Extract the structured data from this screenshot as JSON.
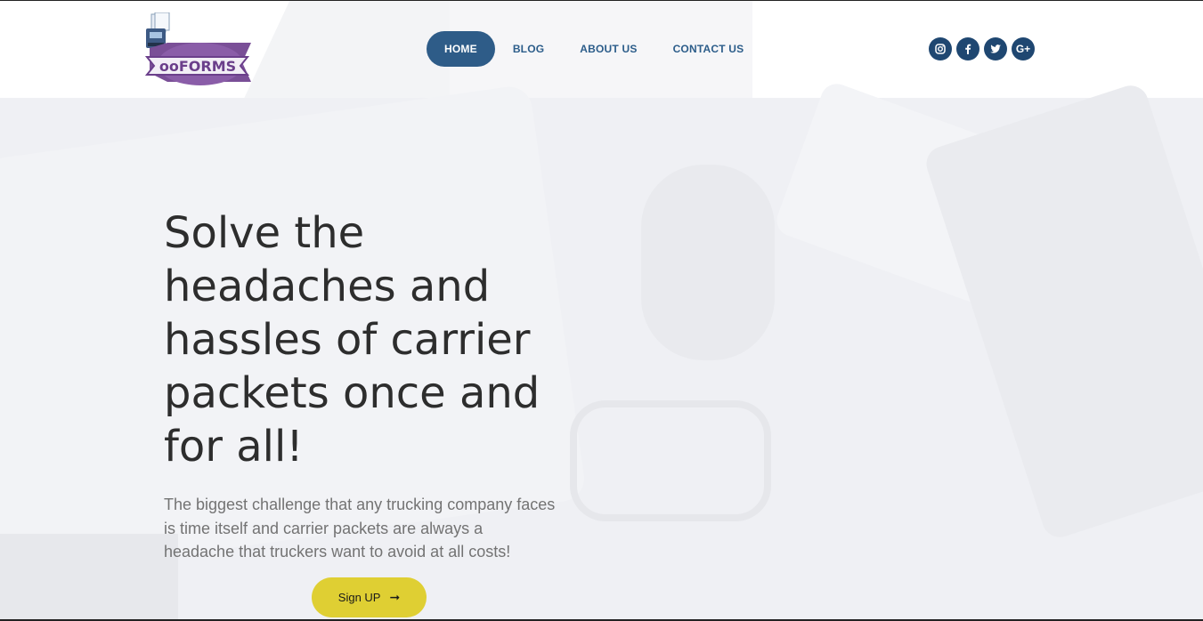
{
  "brand": {
    "logo_text": "ooFORMS",
    "logo_color": "#7a4f97"
  },
  "nav": {
    "items": [
      {
        "label": "HOME",
        "active": true
      },
      {
        "label": "BLOG",
        "active": false
      },
      {
        "label": "ABOUT US",
        "active": false
      },
      {
        "label": "CONTACT US",
        "active": false
      }
    ]
  },
  "social": {
    "icons": [
      "instagram-icon",
      "facebook-icon",
      "twitter-icon",
      "google-plus-icon"
    ],
    "google_plus_text": "G+"
  },
  "hero": {
    "title_lines": [
      "Solve the",
      "headaches and",
      "hassles of carrier",
      "packets once and",
      "for all!"
    ],
    "description": "The biggest challenge that any trucking company faces is time itself and carrier packets are always a headache that truckers want to avoid at all costs!",
    "cta_label": "Sign UP",
    "cta_arrow": "➞"
  },
  "colors": {
    "nav_active_bg": "#2e5c88",
    "nav_text": "#2c5d8a",
    "social_bg": "#1f4771",
    "cta_bg": "#dfcf33",
    "headline": "#2d2d2d"
  }
}
